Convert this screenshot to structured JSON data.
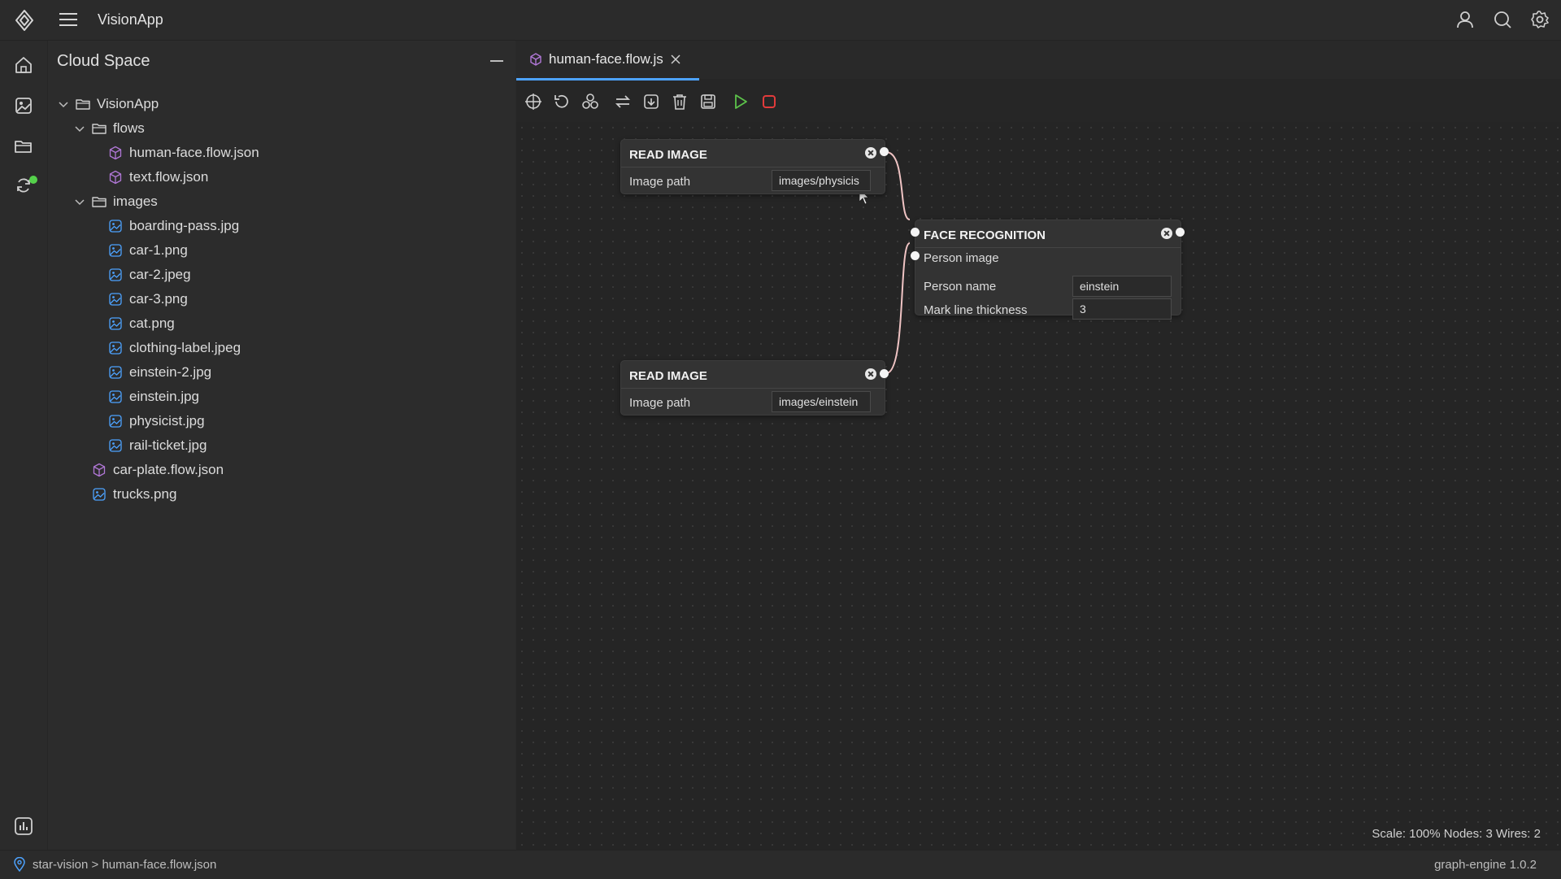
{
  "app": {
    "title": "VisionApp"
  },
  "sidebar": {
    "title": "Cloud Space",
    "tree": [
      {
        "label": "VisionApp",
        "type": "folder",
        "depth": 0,
        "expanded": true
      },
      {
        "label": "flows",
        "type": "folder",
        "depth": 1,
        "expanded": true
      },
      {
        "label": "human-face.flow.json",
        "type": "flow",
        "depth": 2
      },
      {
        "label": "text.flow.json",
        "type": "flow",
        "depth": 2
      },
      {
        "label": "images",
        "type": "folder",
        "depth": 1,
        "expanded": true
      },
      {
        "label": "boarding-pass.jpg",
        "type": "image",
        "depth": 2
      },
      {
        "label": "car-1.png",
        "type": "image",
        "depth": 2
      },
      {
        "label": "car-2.jpeg",
        "type": "image",
        "depth": 2
      },
      {
        "label": "car-3.png",
        "type": "image",
        "depth": 2
      },
      {
        "label": "cat.png",
        "type": "image",
        "depth": 2
      },
      {
        "label": "clothing-label.jpeg",
        "type": "image",
        "depth": 2
      },
      {
        "label": "einstein-2.jpg",
        "type": "image",
        "depth": 2
      },
      {
        "label": "einstein.jpg",
        "type": "image",
        "depth": 2
      },
      {
        "label": "physicist.jpg",
        "type": "image",
        "depth": 2
      },
      {
        "label": "rail-ticket.jpg",
        "type": "image",
        "depth": 2
      },
      {
        "label": "car-plate.flow.json",
        "type": "flow",
        "depth": 1
      },
      {
        "label": "trucks.png",
        "type": "image",
        "depth": 1
      }
    ]
  },
  "editor": {
    "tab": {
      "label": "human-face.flow.js"
    },
    "nodes": {
      "read_image_1": {
        "title": "READ IMAGE",
        "field_label": "Image path",
        "field_value": "images/physicis"
      },
      "face_recognition": {
        "title": "FACE RECOGNITION",
        "input_label": "Person image",
        "name_label": "Person name",
        "name_value": "einstein",
        "thickness_label": "Mark line thickness",
        "thickness_value": "3"
      },
      "read_image_2": {
        "title": "READ IMAGE",
        "field_label": "Image path",
        "field_value": "images/einstein"
      }
    },
    "stats": "Scale: 100% Nodes: 3 Wires: 2"
  },
  "statusbar": {
    "breadcrumb": "star-vision > human-face.flow.json",
    "version": "graph-engine 1.0.2"
  },
  "colors": {
    "accent": "#4da3ff",
    "run": "#5cc24a",
    "stop": "#e23b3b",
    "flow_icon": "#b077d6",
    "image_icon": "#4da3ff",
    "badge": "#55d14b"
  }
}
